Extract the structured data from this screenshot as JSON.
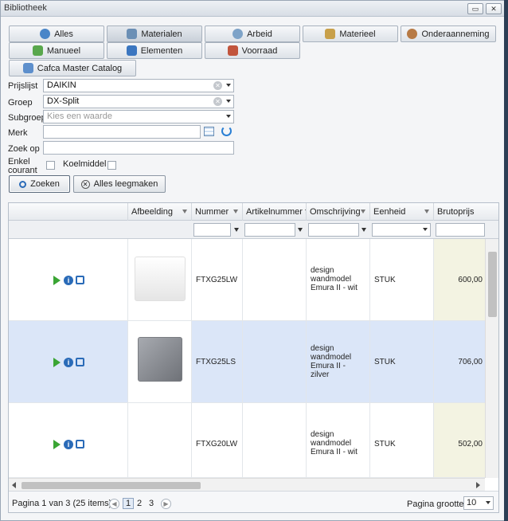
{
  "window": {
    "title": "Bibliotheek",
    "minimize_label": "▭",
    "close_label": "✕"
  },
  "tabs": [
    {
      "label": "Alles",
      "icon": "globe-icon"
    },
    {
      "label": "Materialen",
      "icon": "materials-icon"
    },
    {
      "label": "Arbeid",
      "icon": "clock-icon"
    },
    {
      "label": "Materieel",
      "icon": "tools-icon"
    },
    {
      "label": "Onderaanneming",
      "icon": "person-icon"
    },
    {
      "label": "Manueel",
      "icon": "document-icon"
    },
    {
      "label": "Elementen",
      "icon": "elements-icon"
    },
    {
      "label": "Voorraad",
      "icon": "stock-icon"
    },
    {
      "label": "Cafca Master Catalog",
      "icon": "catalog-icon"
    }
  ],
  "form": {
    "prijslijst_label": "Prijslijst",
    "prijslijst_value": "DAIKIN",
    "groep_label": "Groep",
    "groep_value": "DX-Split",
    "subgroep_label": "Subgroep",
    "subgroep_placeholder": "Kies een waarde",
    "merk_label": "Merk",
    "merk_value": "",
    "zoekop_label": "Zoek op",
    "zoekop_value": "",
    "enkel_label_1": "Enkel",
    "enkel_label_2": "courant",
    "koelmiddel_label": "Koelmiddel"
  },
  "buttons": {
    "search": "Zoeken",
    "clear": "Alles leegmaken"
  },
  "grid": {
    "columns": [
      "Afbeelding",
      "Nummer",
      "Artikelnummer fa",
      "Omschrijving",
      "Eenheid",
      "Brutoprijs"
    ],
    "rows": [
      {
        "nummer": "FTXG25LW",
        "omschrijving": [
          "design",
          "wandmodel",
          "Emura II - wit"
        ],
        "eenheid": "STUK",
        "prijs": "600,00",
        "unit_color": "#f2f2f2"
      },
      {
        "nummer": "FTXG25LS",
        "omschrijving": [
          "design",
          "wandmodel",
          "Emura II -",
          "zilver"
        ],
        "eenheid": "STUK",
        "prijs": "706,00",
        "unit_color": "#8a8d92"
      },
      {
        "nummer": "FTXG20LW",
        "omschrijving": [
          "design",
          "wandmodel",
          "Emura II - wit"
        ],
        "eenheid": "STUK",
        "prijs": "502,00",
        "unit_color": "#f2f2f2"
      }
    ]
  },
  "pager": {
    "info": "Pagina 1 van 3 (25 items)",
    "pages": [
      "1",
      "2",
      "3"
    ],
    "size_label": "Pagina grootte:",
    "size_value": "10"
  },
  "colors": {
    "accent": "#2a6bb8",
    "selected_row": "#dbe6f8",
    "price_col": "#f3f3e2"
  }
}
